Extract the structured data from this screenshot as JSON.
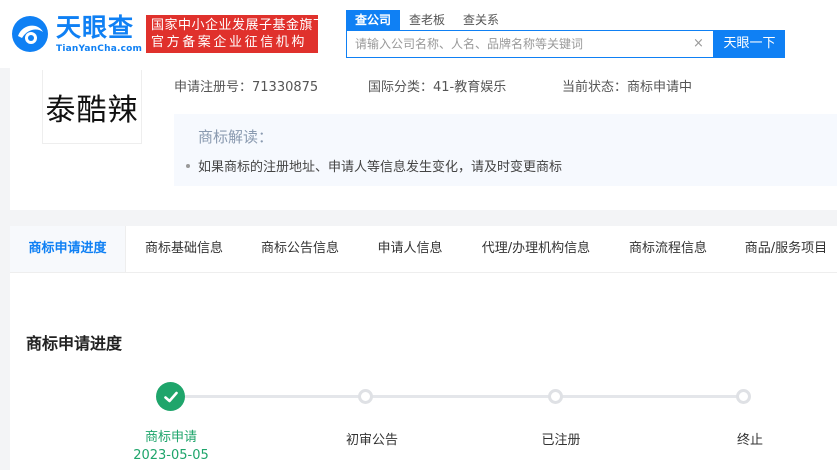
{
  "header": {
    "logo_text": "天眼查",
    "logo_sub": "TianYanCha.com",
    "badge_line1": "国家中小企业发展子基金旗下",
    "badge_line2": "官方备案企业征信机构",
    "search_tabs": [
      "查公司",
      "查老板",
      "查关系"
    ],
    "search_placeholder": "请输入公司名称、人名、品牌名称等关键词",
    "search_button": "天眼一下",
    "clear_icon": "×"
  },
  "trademark": {
    "name": "泰酷辣",
    "reg_no": "申请注册号：71330875",
    "intl_class": "国际分类：41-教育娱乐",
    "status": "当前状态：商标申请中",
    "interp_title": "商标解读：",
    "interp_item": "如果商标的注册地址、申请人等信息发生变化，请及时变更商标"
  },
  "tabs": [
    "商标申请进度",
    "商标基础信息",
    "商标公告信息",
    "申请人信息",
    "代理/办理机构信息",
    "商标流程信息",
    "商品/服务项目"
  ],
  "progress": {
    "title": "商标申请进度",
    "steps": [
      {
        "label": "商标申请",
        "date": "2023-05-05",
        "done": true
      },
      {
        "label": "初审公告",
        "date": "",
        "done": false
      },
      {
        "label": "已注册",
        "date": "",
        "done": false
      },
      {
        "label": "终止",
        "date": "",
        "done": false
      }
    ]
  },
  "colors": {
    "brand": "#0f80f4",
    "badge": "#e0312c",
    "done": "#1fa56b"
  },
  "icons": {
    "logo": "tianyancha-logo-icon",
    "check": "check-icon",
    "clear": "clear-icon"
  }
}
